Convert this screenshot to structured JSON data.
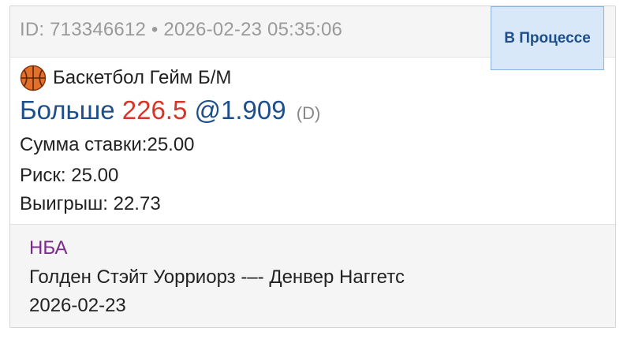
{
  "bet": {
    "id_line": "ID: 713346612 • 2026-02-23 05:35:06",
    "status": "В Процессе",
    "sport_market": "Баскетбол Гейм Б/М",
    "sport_icon": "basketball-icon",
    "selection_name": "Больше",
    "selection_line": "226.5",
    "selection_odds": "@1.909",
    "odds_type": "(D)",
    "stake_line": "Сумма ставки:25.00",
    "risk_line": "Риск: 25.00",
    "win_line": "Выигрыш: 22.73"
  },
  "event": {
    "league": "НБА",
    "teams": "Голден Стэйт Уорриорз -–- Денвер Наггетс",
    "date": "2026-02-23"
  },
  "colors": {
    "status_bg": "#d8e8f8",
    "status_text": "#1f4f8a",
    "selection_blue": "#1f4f8a",
    "line_red": "#d8352a",
    "league_purple": "#7a2a8a",
    "muted_gray": "#9a9a9a"
  }
}
